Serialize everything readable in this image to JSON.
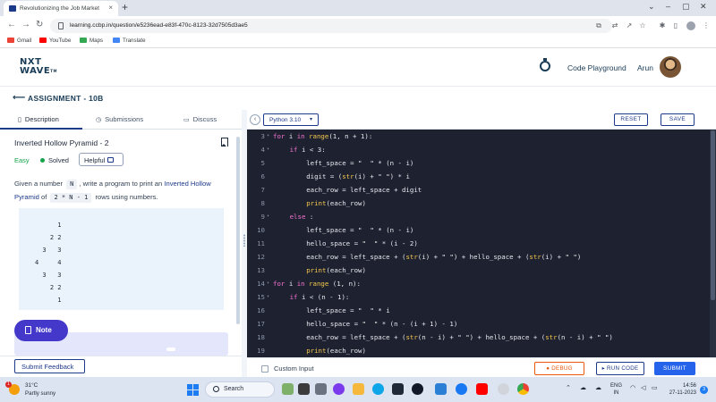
{
  "browser": {
    "tab_title": "Revolutionizing the Job Market",
    "url": "learning.ccbp.in/question/e5236ead-e83f-470c-8123-32d7505d3ae5",
    "bookmarks": [
      "Gmail",
      "YouTube",
      "Maps",
      "Translate"
    ]
  },
  "header": {
    "logo_line1": "NXT",
    "logo_line2": "WAVE",
    "logo_tm": "TM",
    "code_playground": "Code Playground",
    "user_name": "Arun"
  },
  "assignment": {
    "title": "ASSIGNMENT - 10B"
  },
  "left_tabs": [
    "Description",
    "Submissions",
    "Discuss"
  ],
  "problem": {
    "title": "Inverted Hollow Pyramid - 2",
    "difficulty": "Easy",
    "status": "Solved",
    "helpful_label": "Helpful",
    "desc_1": "Given a number",
    "desc_var": "N",
    "desc_2": ", write a program to print an",
    "desc_link": "Inverted Hollow Pyramid",
    "desc_3": "of",
    "desc_expr": "2 * N - 1",
    "desc_4": "rows using numbers.",
    "sample_output": [
      "      1",
      "    2 2",
      "  3   3",
      "4     4",
      "  3   3",
      "    2 2",
      "      1"
    ]
  },
  "note": {
    "label": "Note"
  },
  "left_footer": {
    "submit_feedback": "Submit Feedback"
  },
  "editor_toolbar": {
    "language": "Python 3.10",
    "reset": "RESET",
    "save": "SAVE"
  },
  "code_lines": [
    {
      "n": "3",
      "fold": true,
      "indent": 0,
      "tokens": [
        [
          "kw",
          "for"
        ],
        [
          "",
          "i "
        ],
        [
          "kw",
          "in"
        ],
        [
          "fn",
          "range"
        ],
        [
          "",
          "(1, n + 1):"
        ]
      ]
    },
    {
      "n": "4",
      "fold": true,
      "indent": 1,
      "tokens": [
        [
          "kw",
          "if"
        ],
        [
          "",
          "i < 3:"
        ]
      ]
    },
    {
      "n": "5",
      "fold": false,
      "indent": 2,
      "tokens": [
        [
          "",
          "left_space = "
        ],
        [
          "str",
          "\"  \""
        ],
        [
          "",
          " * (n - i)"
        ]
      ]
    },
    {
      "n": "6",
      "fold": false,
      "indent": 2,
      "tokens": [
        [
          "",
          "digit = ("
        ],
        [
          "fn",
          "str"
        ],
        [
          "",
          "(i) + "
        ],
        [
          "str",
          "\" \""
        ],
        [
          "",
          ") * i"
        ]
      ]
    },
    {
      "n": "7",
      "fold": false,
      "indent": 2,
      "tokens": [
        [
          "",
          "each_row = left_space + digit"
        ]
      ]
    },
    {
      "n": "8",
      "fold": false,
      "indent": 2,
      "tokens": [
        [
          "fn",
          "print"
        ],
        [
          "",
          "(each_row)"
        ]
      ]
    },
    {
      "n": "9",
      "fold": true,
      "indent": 1,
      "tokens": [
        [
          "kw",
          "else"
        ],
        [
          "",
          ":"
        ]
      ]
    },
    {
      "n": "10",
      "fold": false,
      "indent": 2,
      "tokens": [
        [
          "",
          "left_space = "
        ],
        [
          "str",
          "\"  \""
        ],
        [
          "",
          " * (n - i)"
        ]
      ]
    },
    {
      "n": "11",
      "fold": false,
      "indent": 2,
      "tokens": [
        [
          "",
          "hello_space = "
        ],
        [
          "str",
          "\"  \""
        ],
        [
          "",
          " * (i - 2)"
        ]
      ]
    },
    {
      "n": "12",
      "fold": false,
      "indent": 2,
      "tokens": [
        [
          "",
          "each_row = left_space + ("
        ],
        [
          "fn",
          "str"
        ],
        [
          "",
          "(i) + "
        ],
        [
          "str",
          "\" \""
        ],
        [
          "",
          ") + hello_space + ("
        ],
        [
          "fn",
          "str"
        ],
        [
          "",
          "(i) + "
        ],
        [
          "str",
          "\" \""
        ],
        [
          "",
          ")"
        ]
      ]
    },
    {
      "n": "13",
      "fold": false,
      "indent": 2,
      "tokens": [
        [
          "fn",
          "print"
        ],
        [
          "",
          "(each_row)"
        ]
      ]
    },
    {
      "n": "14",
      "fold": true,
      "indent": 0,
      "tokens": [
        [
          "kw",
          "for"
        ],
        [
          "",
          "i "
        ],
        [
          "kw",
          "in"
        ],
        [
          "fn",
          "range"
        ],
        [
          "",
          " (1, n):"
        ]
      ]
    },
    {
      "n": "15",
      "fold": true,
      "indent": 1,
      "tokens": [
        [
          "kw",
          "if"
        ],
        [
          "",
          "i < (n - 1):"
        ]
      ]
    },
    {
      "n": "16",
      "fold": false,
      "indent": 2,
      "tokens": [
        [
          "",
          "left_space = "
        ],
        [
          "str",
          "\"  \""
        ],
        [
          "",
          " * i"
        ]
      ]
    },
    {
      "n": "17",
      "fold": false,
      "indent": 2,
      "tokens": [
        [
          "",
          "hello_space = "
        ],
        [
          "str",
          "\"  \""
        ],
        [
          "",
          " * (n - (i + 1) - 1)"
        ]
      ]
    },
    {
      "n": "18",
      "fold": false,
      "indent": 2,
      "tokens": [
        [
          "",
          "each_row = left_space + ("
        ],
        [
          "fn",
          "str"
        ],
        [
          "",
          "(n - i) + "
        ],
        [
          "str",
          "\" \""
        ],
        [
          "",
          ") + hello_space + ("
        ],
        [
          "fn",
          "str"
        ],
        [
          "",
          "(n - i) + "
        ],
        [
          "str",
          "\" \""
        ],
        [
          "",
          ")"
        ]
      ]
    },
    {
      "n": "19",
      "fold": false,
      "indent": 2,
      "tokens": [
        [
          "fn",
          "print"
        ],
        [
          "",
          "(each_row)"
        ]
      ]
    }
  ],
  "editor_footer": {
    "custom_input": "Custom Input",
    "debug": "DEBUG",
    "run": "RUN CODE",
    "submit": "SUBMIT"
  },
  "taskbar": {
    "temp": "31°C",
    "condition": "Partly sunny",
    "search": "Search",
    "lang_1": "ENG",
    "lang_2": "IN",
    "time": "14:56",
    "date": "27-11-2023",
    "notif_count": "3",
    "weather_badge": "1"
  }
}
